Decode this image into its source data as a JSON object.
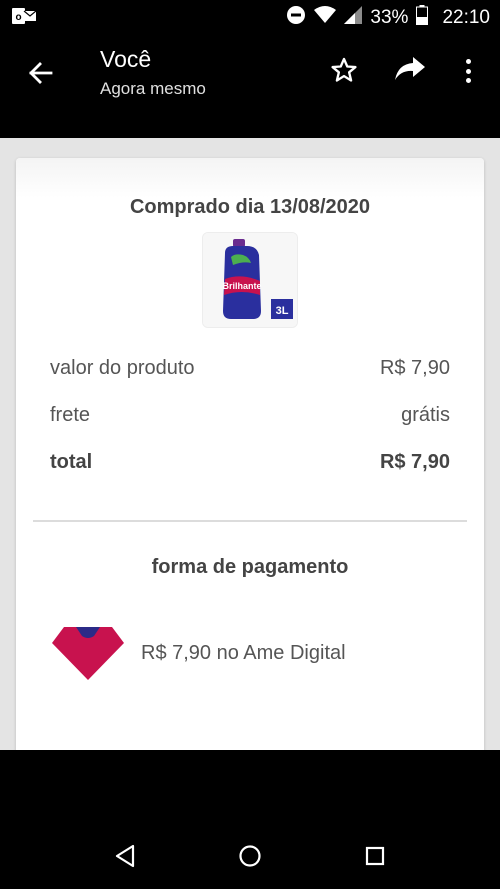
{
  "status_bar": {
    "battery_percent": "33%",
    "time": "22:10"
  },
  "app_bar": {
    "title": "Você",
    "subtitle": "Agora mesmo"
  },
  "receipt": {
    "purchase_title": "Comprado dia 13/08/2020",
    "product_image_text": "Brilhante",
    "product_size_badge": "3L",
    "rows": [
      {
        "label": "valor do produto",
        "value": "R$ 7,90"
      },
      {
        "label": "frete",
        "value": "grátis"
      },
      {
        "label": "total",
        "value": "R$ 7,90"
      }
    ],
    "payment_title": "forma de pagamento",
    "payment_description": "R$ 7,90 no Ame Digital"
  },
  "colors": {
    "ame_primary": "#c8124e",
    "ame_secondary": "#2b2a87",
    "product_blue": "#2a2f9e"
  }
}
